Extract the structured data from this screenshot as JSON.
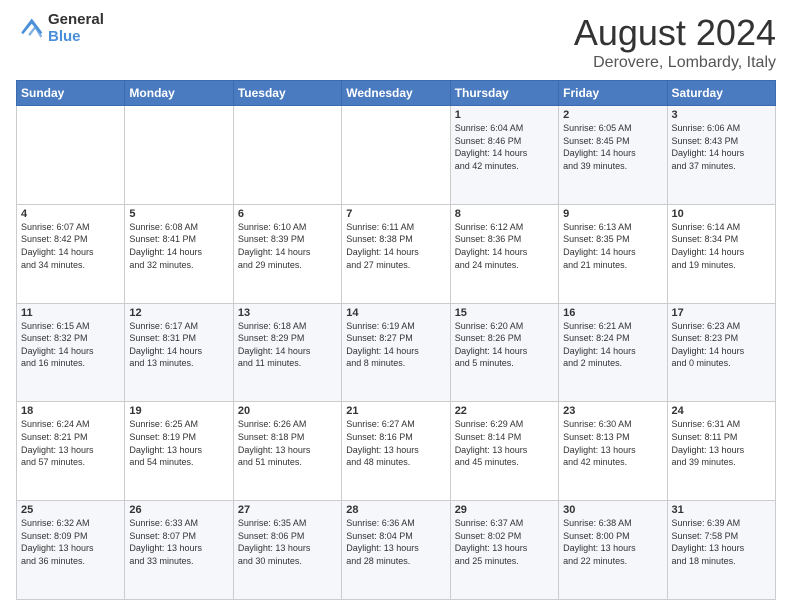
{
  "logo": {
    "general": "General",
    "blue": "Blue"
  },
  "header": {
    "month": "August 2024",
    "location": "Derovere, Lombardy, Italy"
  },
  "weekdays": [
    "Sunday",
    "Monday",
    "Tuesday",
    "Wednesday",
    "Thursday",
    "Friday",
    "Saturday"
  ],
  "weeks": [
    [
      {
        "day": "",
        "info": ""
      },
      {
        "day": "",
        "info": ""
      },
      {
        "day": "",
        "info": ""
      },
      {
        "day": "",
        "info": ""
      },
      {
        "day": "1",
        "info": "Sunrise: 6:04 AM\nSunset: 8:46 PM\nDaylight: 14 hours\nand 42 minutes."
      },
      {
        "day": "2",
        "info": "Sunrise: 6:05 AM\nSunset: 8:45 PM\nDaylight: 14 hours\nand 39 minutes."
      },
      {
        "day": "3",
        "info": "Sunrise: 6:06 AM\nSunset: 8:43 PM\nDaylight: 14 hours\nand 37 minutes."
      }
    ],
    [
      {
        "day": "4",
        "info": "Sunrise: 6:07 AM\nSunset: 8:42 PM\nDaylight: 14 hours\nand 34 minutes."
      },
      {
        "day": "5",
        "info": "Sunrise: 6:08 AM\nSunset: 8:41 PM\nDaylight: 14 hours\nand 32 minutes."
      },
      {
        "day": "6",
        "info": "Sunrise: 6:10 AM\nSunset: 8:39 PM\nDaylight: 14 hours\nand 29 minutes."
      },
      {
        "day": "7",
        "info": "Sunrise: 6:11 AM\nSunset: 8:38 PM\nDaylight: 14 hours\nand 27 minutes."
      },
      {
        "day": "8",
        "info": "Sunrise: 6:12 AM\nSunset: 8:36 PM\nDaylight: 14 hours\nand 24 minutes."
      },
      {
        "day": "9",
        "info": "Sunrise: 6:13 AM\nSunset: 8:35 PM\nDaylight: 14 hours\nand 21 minutes."
      },
      {
        "day": "10",
        "info": "Sunrise: 6:14 AM\nSunset: 8:34 PM\nDaylight: 14 hours\nand 19 minutes."
      }
    ],
    [
      {
        "day": "11",
        "info": "Sunrise: 6:15 AM\nSunset: 8:32 PM\nDaylight: 14 hours\nand 16 minutes."
      },
      {
        "day": "12",
        "info": "Sunrise: 6:17 AM\nSunset: 8:31 PM\nDaylight: 14 hours\nand 13 minutes."
      },
      {
        "day": "13",
        "info": "Sunrise: 6:18 AM\nSunset: 8:29 PM\nDaylight: 14 hours\nand 11 minutes."
      },
      {
        "day": "14",
        "info": "Sunrise: 6:19 AM\nSunset: 8:27 PM\nDaylight: 14 hours\nand 8 minutes."
      },
      {
        "day": "15",
        "info": "Sunrise: 6:20 AM\nSunset: 8:26 PM\nDaylight: 14 hours\nand 5 minutes."
      },
      {
        "day": "16",
        "info": "Sunrise: 6:21 AM\nSunset: 8:24 PM\nDaylight: 14 hours\nand 2 minutes."
      },
      {
        "day": "17",
        "info": "Sunrise: 6:23 AM\nSunset: 8:23 PM\nDaylight: 14 hours\nand 0 minutes."
      }
    ],
    [
      {
        "day": "18",
        "info": "Sunrise: 6:24 AM\nSunset: 8:21 PM\nDaylight: 13 hours\nand 57 minutes."
      },
      {
        "day": "19",
        "info": "Sunrise: 6:25 AM\nSunset: 8:19 PM\nDaylight: 13 hours\nand 54 minutes."
      },
      {
        "day": "20",
        "info": "Sunrise: 6:26 AM\nSunset: 8:18 PM\nDaylight: 13 hours\nand 51 minutes."
      },
      {
        "day": "21",
        "info": "Sunrise: 6:27 AM\nSunset: 8:16 PM\nDaylight: 13 hours\nand 48 minutes."
      },
      {
        "day": "22",
        "info": "Sunrise: 6:29 AM\nSunset: 8:14 PM\nDaylight: 13 hours\nand 45 minutes."
      },
      {
        "day": "23",
        "info": "Sunrise: 6:30 AM\nSunset: 8:13 PM\nDaylight: 13 hours\nand 42 minutes."
      },
      {
        "day": "24",
        "info": "Sunrise: 6:31 AM\nSunset: 8:11 PM\nDaylight: 13 hours\nand 39 minutes."
      }
    ],
    [
      {
        "day": "25",
        "info": "Sunrise: 6:32 AM\nSunset: 8:09 PM\nDaylight: 13 hours\nand 36 minutes."
      },
      {
        "day": "26",
        "info": "Sunrise: 6:33 AM\nSunset: 8:07 PM\nDaylight: 13 hours\nand 33 minutes."
      },
      {
        "day": "27",
        "info": "Sunrise: 6:35 AM\nSunset: 8:06 PM\nDaylight: 13 hours\nand 30 minutes."
      },
      {
        "day": "28",
        "info": "Sunrise: 6:36 AM\nSunset: 8:04 PM\nDaylight: 13 hours\nand 28 minutes."
      },
      {
        "day": "29",
        "info": "Sunrise: 6:37 AM\nSunset: 8:02 PM\nDaylight: 13 hours\nand 25 minutes."
      },
      {
        "day": "30",
        "info": "Sunrise: 6:38 AM\nSunset: 8:00 PM\nDaylight: 13 hours\nand 22 minutes."
      },
      {
        "day": "31",
        "info": "Sunrise: 6:39 AM\nSunset: 7:58 PM\nDaylight: 13 hours\nand 18 minutes."
      }
    ]
  ]
}
